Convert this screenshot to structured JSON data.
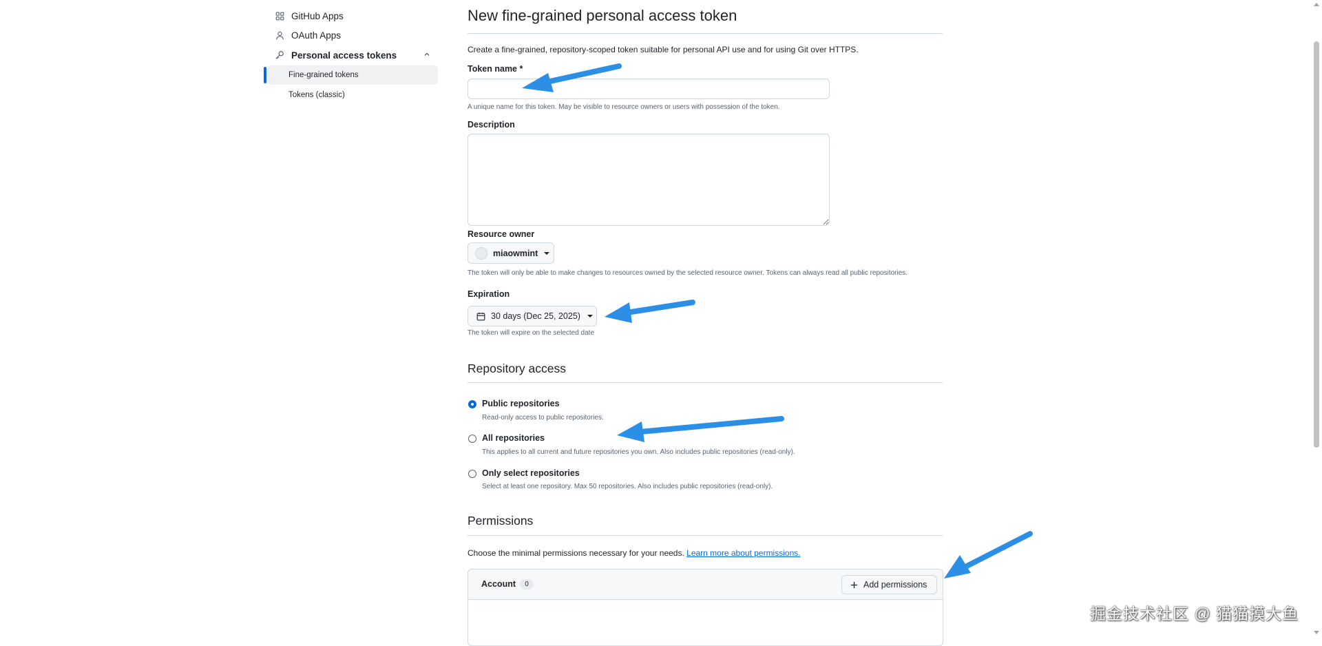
{
  "sidebar": {
    "items": [
      {
        "label": "GitHub Apps",
        "icon": "apps-grid-icon"
      },
      {
        "label": "OAuth Apps",
        "icon": "person-icon"
      },
      {
        "label": "Personal access tokens",
        "icon": "key-icon"
      }
    ],
    "subitems": [
      {
        "label": "Fine-grained tokens",
        "active": true
      },
      {
        "label": "Tokens (classic)",
        "active": false
      }
    ]
  },
  "page": {
    "title": "New fine-grained personal access token",
    "intro": "Create a fine-grained, repository-scoped token suitable for personal API use and for using Git over HTTPS."
  },
  "token_name": {
    "label": "Token name *",
    "value": "",
    "note": "A unique name for this token. May be visible to resource owners or users with possession of the token."
  },
  "description": {
    "label": "Description",
    "value": ""
  },
  "resource_owner": {
    "label": "Resource owner",
    "value": "miaowmint",
    "note": "The token will only be able to make changes to resources owned by the selected resource owner. Tokens can always read all public repositories."
  },
  "expiration": {
    "label": "Expiration",
    "value": "30 days (Dec 25, 2025)",
    "note": "The token will expire on the selected date"
  },
  "repository_access": {
    "heading": "Repository access",
    "options": [
      {
        "label": "Public repositories",
        "note": "Read-only access to public repositories.",
        "checked": true
      },
      {
        "label": "All repositories",
        "note": "This applies to all current and future repositories you own. Also includes public repositories (read-only).",
        "checked": false
      },
      {
        "label": "Only select repositories",
        "note": "Select at least one repository. Max 50 repositories. Also includes public repositories (read-only).",
        "checked": false
      }
    ]
  },
  "permissions": {
    "heading": "Permissions",
    "intro": "Choose the minimal permissions necessary for your needs.",
    "link": "Learn more about permissions.",
    "account_label": "Account",
    "account_count": "0",
    "add_button": "Add permissions"
  },
  "watermark": "掘金技术社区 @ 猫猫摸大鱼",
  "colors": {
    "accent": "#0969da",
    "annotation_arrow": "#2b8fe6"
  }
}
